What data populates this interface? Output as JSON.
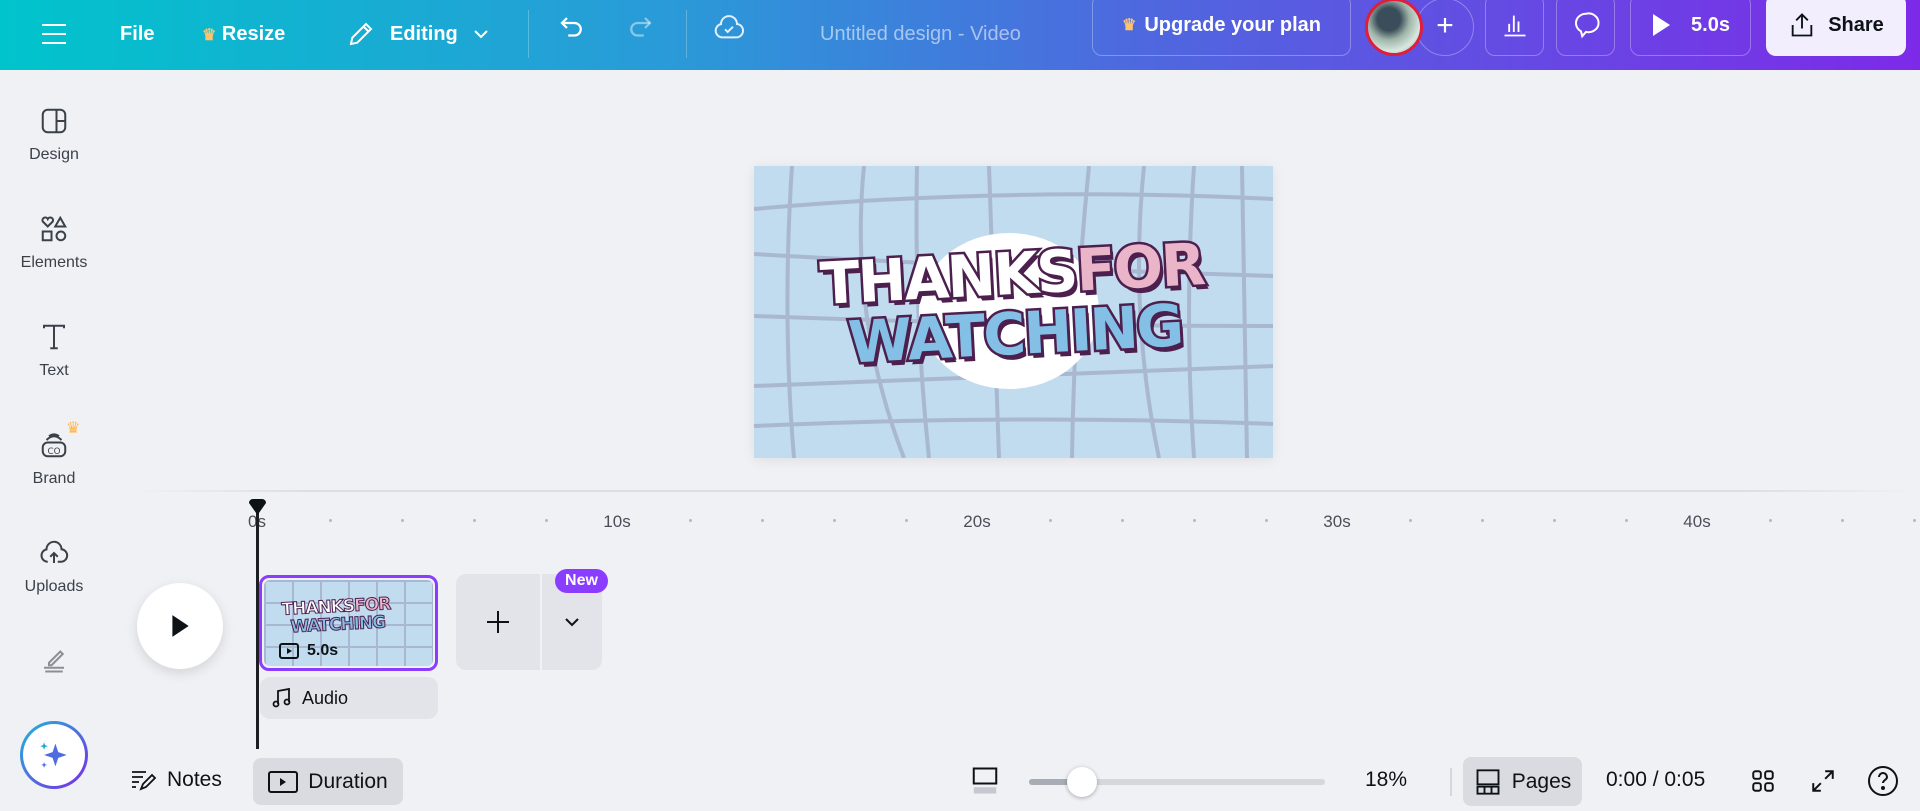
{
  "topbar": {
    "file": "File",
    "resize": "Resize",
    "editing": "Editing",
    "title": "Untitled design - Video",
    "upgrade": "Upgrade your plan",
    "play_duration": "5.0s",
    "share": "Share"
  },
  "sidebar": {
    "items": [
      {
        "label": "Design"
      },
      {
        "label": "Elements"
      },
      {
        "label": "Text"
      },
      {
        "label": "Brand"
      },
      {
        "label": "Uploads"
      }
    ]
  },
  "canvas": {
    "line1a": "THANKS",
    "line1b": "FOR",
    "line2": "WATCHING"
  },
  "timeline": {
    "ticks": [
      "0s",
      "10s",
      "20s",
      "30s",
      "40s"
    ],
    "clip_duration": "5.0s",
    "audio": "Audio",
    "new_badge": "New"
  },
  "bottombar": {
    "notes": "Notes",
    "duration": "Duration",
    "zoom": "18%",
    "zoom_fraction": 0.18,
    "pages": "Pages",
    "time": "0:00 / 0:05"
  },
  "colors": {
    "gradient_start": "#00c4cc",
    "gradient_end": "#7d2ae8",
    "accent": "#8b3dff"
  }
}
